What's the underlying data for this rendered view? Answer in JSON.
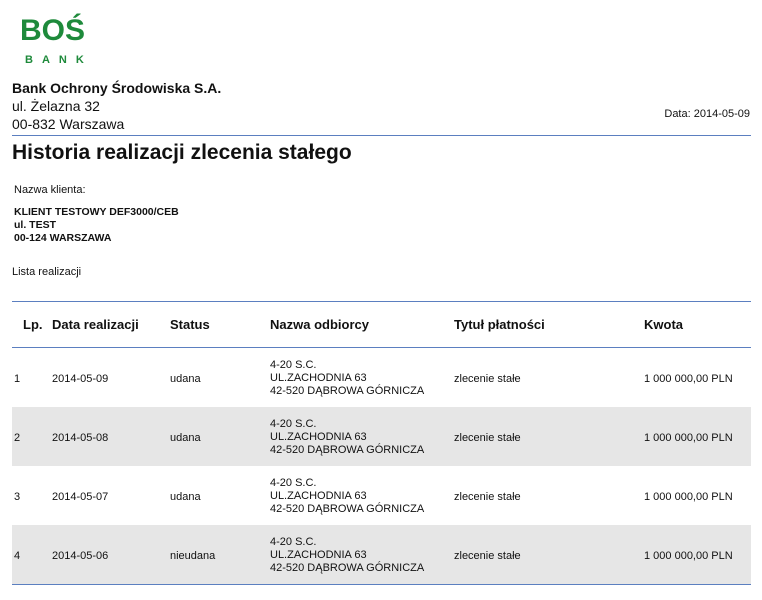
{
  "logo": {
    "main": "BOŚ",
    "sub": "BANK"
  },
  "bank": {
    "name": "Bank Ochrony Środowiska S.A.",
    "street": "ul. Żelazna 32",
    "city": "00-832 Warszawa"
  },
  "date_label": "Data: 2014-05-09",
  "title": "Historia realizacji zlecenia stałego",
  "client": {
    "label": "Nazwa klienta:",
    "line1": "KLIENT TESTOWY DEF3000/CEB",
    "line2": "ul. TEST",
    "line3": "00-124 WARSZAWA"
  },
  "list_label": "Lista realizacji",
  "table": {
    "headers": {
      "lp": "Lp.",
      "date": "Data realizacji",
      "status": "Status",
      "recipient": "Nazwa odbiorcy",
      "title": "Tytuł płatności",
      "amount": "Kwota"
    },
    "rows": [
      {
        "lp": "1",
        "date": "2014-05-09",
        "status": "udana",
        "rec1": "4-20 S.C.",
        "rec2": "UL.ZACHODNIA 63",
        "rec3": "42-520 DĄBROWA GÓRNICZA",
        "title": "zlecenie stałe",
        "amount": "1 000 000,00 PLN"
      },
      {
        "lp": "2",
        "date": "2014-05-08",
        "status": "udana",
        "rec1": "4-20 S.C.",
        "rec2": "UL.ZACHODNIA 63",
        "rec3": "42-520 DĄBROWA GÓRNICZA",
        "title": "zlecenie stałe",
        "amount": "1 000 000,00 PLN"
      },
      {
        "lp": "3",
        "date": "2014-05-07",
        "status": "udana",
        "rec1": "4-20 S.C.",
        "rec2": "UL.ZACHODNIA 63",
        "rec3": "42-520 DĄBROWA GÓRNICZA",
        "title": "zlecenie stałe",
        "amount": "1 000 000,00 PLN"
      },
      {
        "lp": "4",
        "date": "2014-05-06",
        "status": "nieudana",
        "rec1": "4-20 S.C.",
        "rec2": "UL.ZACHODNIA 63",
        "rec3": "42-520 DĄBROWA GÓRNICZA",
        "title": "zlecenie stałe",
        "amount": "1 000 000,00 PLN"
      }
    ]
  },
  "colors": {
    "brand": "#1e8a3b",
    "rule": "#5b7fc0",
    "row_alt": "#e6e6e6"
  }
}
